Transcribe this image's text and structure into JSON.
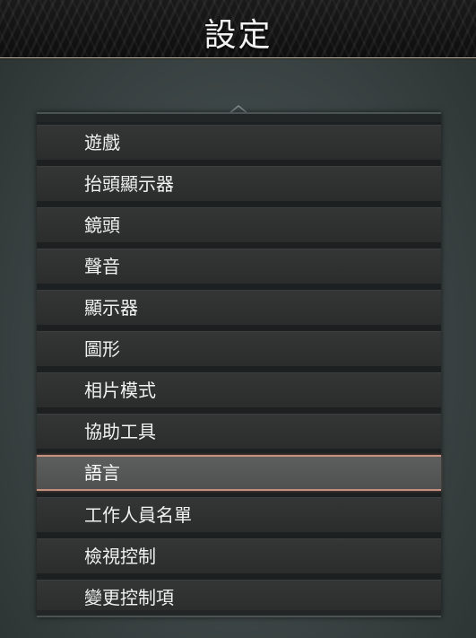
{
  "header": {
    "title": "設定"
  },
  "menu": {
    "selected_index": 8,
    "items": [
      {
        "label": "遊戲"
      },
      {
        "label": "抬頭顯示器"
      },
      {
        "label": "鏡頭"
      },
      {
        "label": "聲音"
      },
      {
        "label": "顯示器"
      },
      {
        "label": "圖形"
      },
      {
        "label": "相片模式"
      },
      {
        "label": "協助工具"
      },
      {
        "label": "語言"
      },
      {
        "label": "工作人員名單"
      },
      {
        "label": "檢視控制"
      },
      {
        "label": "變更控制項"
      }
    ]
  },
  "colors": {
    "selection_accent": "#c78f7d",
    "text": "#f1f1f1"
  },
  "icons": {
    "scroll_up": "chevron-up-icon"
  }
}
